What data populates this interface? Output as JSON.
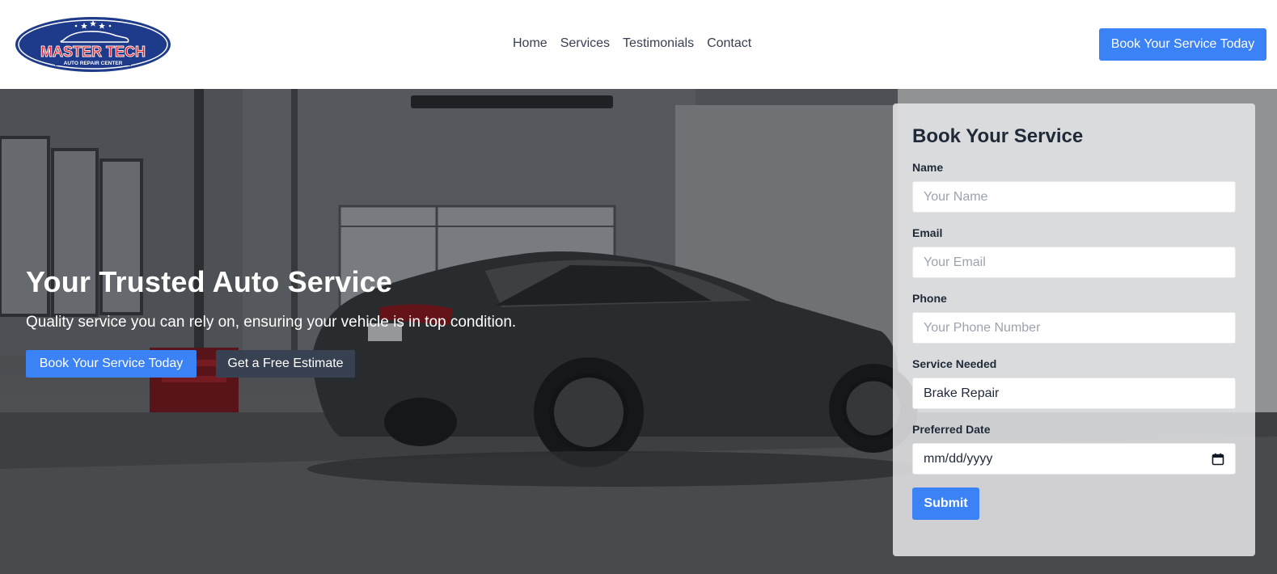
{
  "brand": {
    "logo_main": "MASTER TECH",
    "logo_sub": "AUTO REPAIR CENTER",
    "colors": {
      "navy": "#1e3a8a",
      "red": "#e11d2a",
      "accent": "#3b82f6",
      "dark_button": "#374151"
    }
  },
  "nav": {
    "items": [
      {
        "label": "Home"
      },
      {
        "label": "Services"
      },
      {
        "label": "Testimonials"
      },
      {
        "label": "Contact"
      }
    ],
    "cta_label": "Book Your Service Today"
  },
  "hero": {
    "title": "Your Trusted Auto Service",
    "subtitle": "Quality service you can rely on, ensuring your vehicle is in top condition.",
    "primary_button": "Book Your Service Today",
    "secondary_button": "Get a Free Estimate",
    "background_image": "car-garage-photo"
  },
  "booking_form": {
    "title": "Book Your Service",
    "fields": {
      "name": {
        "label": "Name",
        "placeholder": "Your Name"
      },
      "email": {
        "label": "Email",
        "placeholder": "Your Email"
      },
      "phone": {
        "label": "Phone",
        "placeholder": "Your Phone Number"
      },
      "service": {
        "label": "Service Needed",
        "value": "Brake Repair"
      },
      "date": {
        "label": "Preferred Date",
        "value": "mm/dd/yyyy",
        "icon": "calendar-icon"
      }
    },
    "submit_label": "Submit"
  }
}
